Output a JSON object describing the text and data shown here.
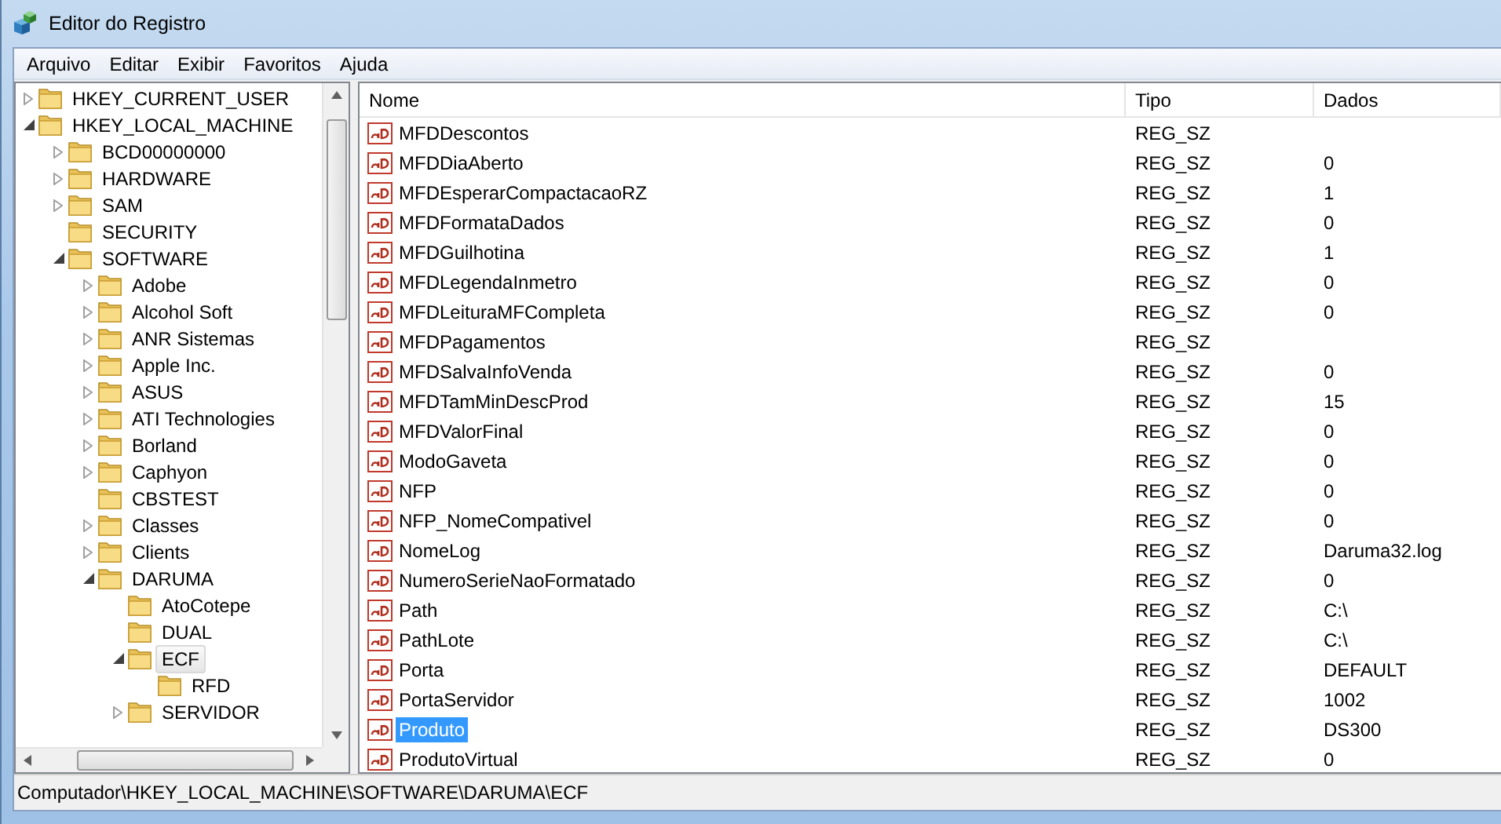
{
  "window": {
    "title": "Editor do Registro"
  },
  "menu": [
    "Arquivo",
    "Editar",
    "Exibir",
    "Favoritos",
    "Ajuda"
  ],
  "tree": [
    {
      "label": "HKEY_CURRENT_USER",
      "expandable": true,
      "expanded": false,
      "selected": false
    },
    {
      "label": "HKEY_LOCAL_MACHINE",
      "expandable": true,
      "expanded": true,
      "selected": false,
      "children": [
        {
          "label": "BCD00000000",
          "expandable": true,
          "expanded": false,
          "selected": false
        },
        {
          "label": "HARDWARE",
          "expandable": true,
          "expanded": false,
          "selected": false
        },
        {
          "label": "SAM",
          "expandable": true,
          "expanded": false,
          "selected": false
        },
        {
          "label": "SECURITY",
          "expandable": false,
          "selected": false
        },
        {
          "label": "SOFTWARE",
          "expandable": true,
          "expanded": true,
          "selected": false,
          "children": [
            {
              "label": "Adobe",
              "expandable": true,
              "expanded": false,
              "selected": false
            },
            {
              "label": "Alcohol Soft",
              "expandable": true,
              "expanded": false,
              "selected": false
            },
            {
              "label": "ANR Sistemas",
              "expandable": true,
              "expanded": false,
              "selected": false
            },
            {
              "label": "Apple Inc.",
              "expandable": true,
              "expanded": false,
              "selected": false
            },
            {
              "label": "ASUS",
              "expandable": true,
              "expanded": false,
              "selected": false
            },
            {
              "label": "ATI Technologies",
              "expandable": true,
              "expanded": false,
              "selected": false
            },
            {
              "label": "Borland",
              "expandable": true,
              "expanded": false,
              "selected": false
            },
            {
              "label": "Caphyon",
              "expandable": true,
              "expanded": false,
              "selected": false
            },
            {
              "label": "CBSTEST",
              "expandable": false,
              "selected": false
            },
            {
              "label": "Classes",
              "expandable": true,
              "expanded": false,
              "selected": false
            },
            {
              "label": "Clients",
              "expandable": true,
              "expanded": false,
              "selected": false
            },
            {
              "label": "DARUMA",
              "expandable": true,
              "expanded": true,
              "selected": false,
              "children": [
                {
                  "label": "AtoCotepe",
                  "expandable": false,
                  "selected": false
                },
                {
                  "label": "DUAL",
                  "expandable": false,
                  "selected": false
                },
                {
                  "label": "ECF",
                  "expandable": true,
                  "expanded": true,
                  "selected": true,
                  "children": [
                    {
                      "label": "RFD",
                      "expandable": false,
                      "selected": false
                    }
                  ]
                },
                {
                  "label": "SERVIDOR",
                  "expandable": true,
                  "expanded": false,
                  "selected": false
                }
              ]
            }
          ]
        }
      ]
    }
  ],
  "table": {
    "columns": [
      "Nome",
      "Tipo",
      "Dados"
    ],
    "rows": [
      {
        "name": "MFDDescontos",
        "type": "REG_SZ",
        "selected": false
      },
      {
        "name": "MFDDiaAberto",
        "type": "REG_SZ",
        "data": "0",
        "selected": false
      },
      {
        "name": "MFDEsperarCompactacaoRZ",
        "type": "REG_SZ",
        "data": "1",
        "selected": false
      },
      {
        "name": "MFDFormataDados",
        "type": "REG_SZ",
        "data": "0",
        "selected": false
      },
      {
        "name": "MFDGuilhotina",
        "type": "REG_SZ",
        "data": "1",
        "selected": false
      },
      {
        "name": "MFDLegendaInmetro",
        "type": "REG_SZ",
        "data": "0",
        "selected": false
      },
      {
        "name": "MFDLeituraMFCompleta",
        "type": "REG_SZ",
        "data": "0",
        "selected": false
      },
      {
        "name": "MFDPagamentos",
        "type": "REG_SZ",
        "selected": false
      },
      {
        "name": "MFDSalvaInfoVenda",
        "type": "REG_SZ",
        "data": "0",
        "selected": false
      },
      {
        "name": "MFDTamMinDescProd",
        "type": "REG_SZ",
        "data": "15",
        "selected": false
      },
      {
        "name": "MFDValorFinal",
        "type": "REG_SZ",
        "data": "0",
        "selected": false
      },
      {
        "name": "ModoGaveta",
        "type": "REG_SZ",
        "data": "0",
        "selected": false
      },
      {
        "name": "NFP",
        "type": "REG_SZ",
        "data": "0",
        "selected": false
      },
      {
        "name": "NFP_NomeCompativel",
        "type": "REG_SZ",
        "data": "0",
        "selected": false
      },
      {
        "name": "NomeLog",
        "type": "REG_SZ",
        "data": "Daruma32.log",
        "selected": false
      },
      {
        "name": "NumeroSerieNaoFormatado",
        "type": "REG_SZ",
        "data": "0",
        "selected": false
      },
      {
        "name": "Path",
        "type": "REG_SZ",
        "data": "C:\\",
        "selected": false
      },
      {
        "name": "PathLote",
        "type": "REG_SZ",
        "data": "C:\\",
        "selected": false
      },
      {
        "name": "Porta",
        "type": "REG_SZ",
        "data": "DEFAULT",
        "selected": false
      },
      {
        "name": "PortaServidor",
        "type": "REG_SZ",
        "data": "1002",
        "selected": false
      },
      {
        "name": "Produto",
        "type": "REG_SZ",
        "data": "DS300",
        "selected": true
      },
      {
        "name": "ProdutoVirtual",
        "type": "REG_SZ",
        "data": "0",
        "selected": false
      }
    ]
  },
  "status_bar": "Computador\\HKEY_LOCAL_MACHINE\\SOFTWARE\\DARUMA\\ECF"
}
